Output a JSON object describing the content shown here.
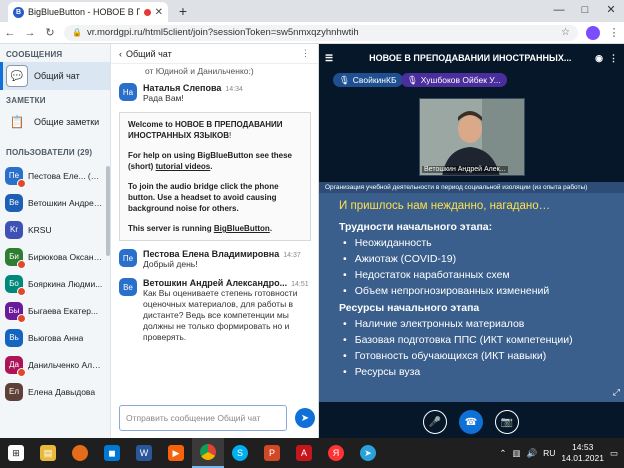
{
  "browser": {
    "tab_title": "BigBlueButton - НОВОЕ В ПРЕ",
    "favicon": "B",
    "url": "vr.mordgpi.ru/html5client/join?sessionToken=sw5nmxqzyhnhwtih",
    "window_controls": [
      "—",
      "□",
      "✕"
    ]
  },
  "sidebar": {
    "messages_header": "СООБЩЕНИЯ",
    "public_chat": "Общий чат",
    "notes_header": "ЗАМЕТКИ",
    "shared_notes": "Общие заметки",
    "users_header": "ПОЛЬЗОВАТЕЛИ (29)",
    "users": [
      {
        "initials": "Пе",
        "name": "Пестова Еле... (Вы)",
        "color": "#2a6fc9",
        "mic": true
      },
      {
        "initials": "Ве",
        "name": "Ветошкин Андрей...",
        "color": "#1d5fb5",
        "mic": false
      },
      {
        "initials": "Kr",
        "name": "KRSU",
        "color": "#3f51b5",
        "mic": false
      },
      {
        "initials": "Би",
        "name": "Бирюкова Оксана...",
        "color": "#2e7d32",
        "mic": true
      },
      {
        "initials": "Бо",
        "name": "Бояркина Людми...",
        "color": "#00897b",
        "mic": true
      },
      {
        "initials": "Бы",
        "name": "Быгаева Екатер...",
        "color": "#6a1b9a",
        "mic": true
      },
      {
        "initials": "Вь",
        "name": "Вьюгова Анна",
        "color": "#1565c0",
        "mic": false
      },
      {
        "initials": "Да",
        "name": "Данильченко Але...",
        "color": "#ad1457",
        "mic": true
      },
      {
        "initials": "Ел",
        "name": "Елена Давыдова",
        "color": "#5d4037",
        "mic": false
      }
    ]
  },
  "chat": {
    "back_label": "Общий чат",
    "first_partial": "от Юдиной и Данильченко:)",
    "messages": [
      {
        "initials": "На",
        "name": "Наталья Слепова",
        "time": "14:34",
        "text": "Рада Вам!"
      },
      {
        "initials": "Пе",
        "name": "Пестова Елена Владимировна",
        "time": "14:37",
        "text": "Добрый день!"
      },
      {
        "initials": "Ве",
        "name": "Ветошкин Андрей Александро...",
        "time": "14:51",
        "text": "Как Вы оцениваете степень готовности оценочных материалов, для работы в дистанте? Ведь все компетенции мы должны не только формировать но и проверять."
      }
    ],
    "welcome": {
      "line1_prefix": "Welcome to ",
      "line1_bold": "НОВОЕ В ПРЕПОДАВАНИИ ИНОСТРАННЫХ ЯЗЫКОВ",
      "line1_suffix": "!",
      "help_prefix": "For help on using BigBlueButton see these (short) ",
      "help_link": "tutorial videos",
      "help_suffix": ".",
      "audio": "To join the audio bridge click the phone button. Use a headset to avoid causing background noise for others.",
      "server_prefix": "This server is running ",
      "server_link": "BigBlueButton",
      "server_suffix": "."
    },
    "input_placeholder": "Отправить сообщение Общий чат"
  },
  "main": {
    "title": "НОВОЕ В ПРЕПОДАВАНИИ ИНОСТРАННЫХ...",
    "pill1": "СвойкинКБ",
    "pill2": "Хушбоков Ойбек У...",
    "video_label": "Ветошкин Андрей Алек...",
    "slide": {
      "topline": "Организация учебной деятельности в период социальной изоляции (из опыта работы)",
      "title": "И пришлось нам нежданно, нагадано…",
      "heading1": "Трудности начального этапа:",
      "items1": [
        "Неожиданность",
        "Ажиотаж (COVID-19)",
        "Недостаток наработанных схем",
        "Объем непрогнозированных изменений"
      ],
      "heading2": "Ресурсы начального этапа",
      "items2": [
        "Наличие электронных материалов",
        "Базовая подготовка ППС (ИКТ компетенции)",
        "Готовность обучающихся (ИКТ навыки)",
        "Ресурсы вуза"
      ]
    }
  },
  "taskbar": {
    "lang": "RU",
    "time": "14:53",
    "date": "14.01.2021"
  }
}
